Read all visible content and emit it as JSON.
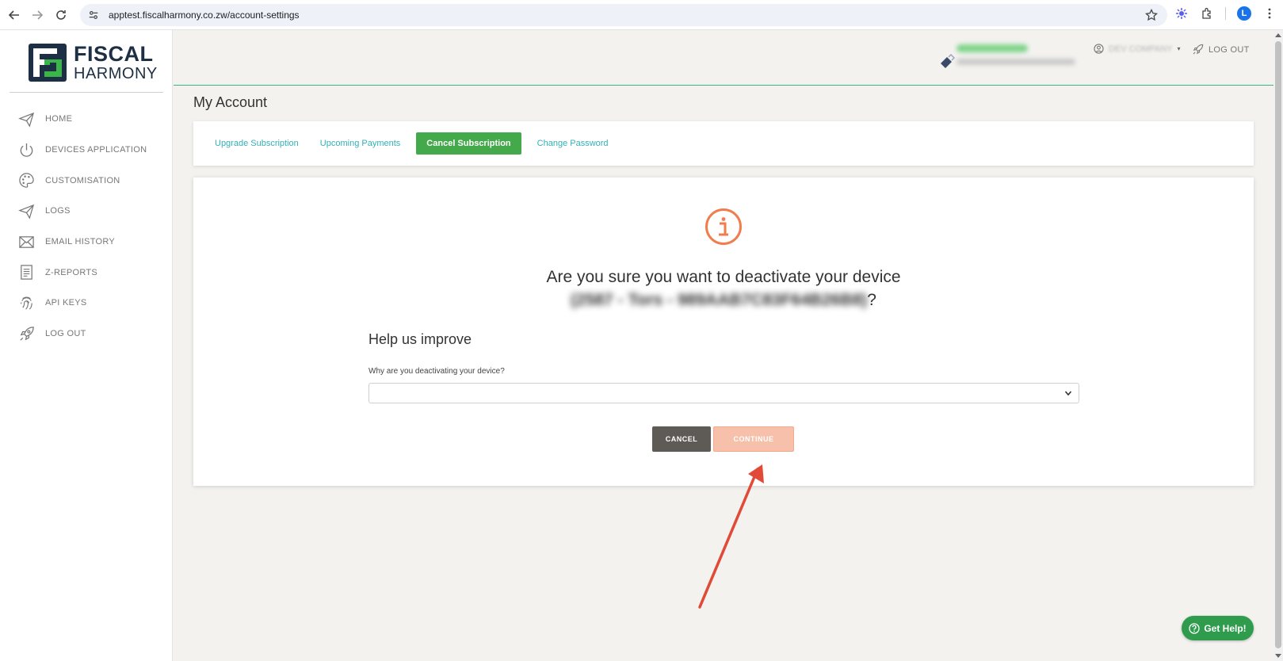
{
  "browser": {
    "url": "apptest.fiscalharmony.co.zw/account-settings",
    "profile_initial": "L"
  },
  "logo": {
    "line1": "FISCAL",
    "line2": "HARMONY",
    "colors": {
      "navy": "#1c2f44",
      "green": "#3bb449"
    }
  },
  "sidebar": {
    "items": [
      {
        "label": "HOME",
        "icon": "paper-plane-icon"
      },
      {
        "label": "DEVICES APPLICATION",
        "icon": "power-icon"
      },
      {
        "label": "CUSTOMISATION",
        "icon": "palette-icon"
      },
      {
        "label": "LOGS",
        "icon": "paper-plane-icon"
      },
      {
        "label": "EMAIL HISTORY",
        "icon": "envelope-icon"
      },
      {
        "label": "Z-REPORTS",
        "icon": "document-icon"
      },
      {
        "label": "API KEYS",
        "icon": "fingerprint-icon"
      },
      {
        "label": "LOG OUT",
        "icon": "rocket-icon"
      }
    ]
  },
  "header": {
    "company_label": "DEV COMPANY",
    "logout_label": "LOG OUT"
  },
  "page": {
    "title": "My Account",
    "tabs": [
      {
        "label": "Upgrade Subscription",
        "active": false
      },
      {
        "label": "Upcoming Payments",
        "active": false
      },
      {
        "label": "Cancel Subscription",
        "active": true
      },
      {
        "label": "Change Password",
        "active": false
      }
    ]
  },
  "dialog": {
    "question_prefix": "Are you sure you want to deactivate your device",
    "device_redacted": "(2587 - Tors - 989AAB7C83F64B26B8)",
    "question_suffix": "?",
    "help_title": "Help us improve",
    "reason_label": "Why are you deactivating your device?",
    "reason_selected": "",
    "cancel_label": "CANCEL",
    "continue_label": "CONTINUE",
    "accent_color": "#ef7d4d"
  },
  "help_button": {
    "label": "Get Help!"
  }
}
